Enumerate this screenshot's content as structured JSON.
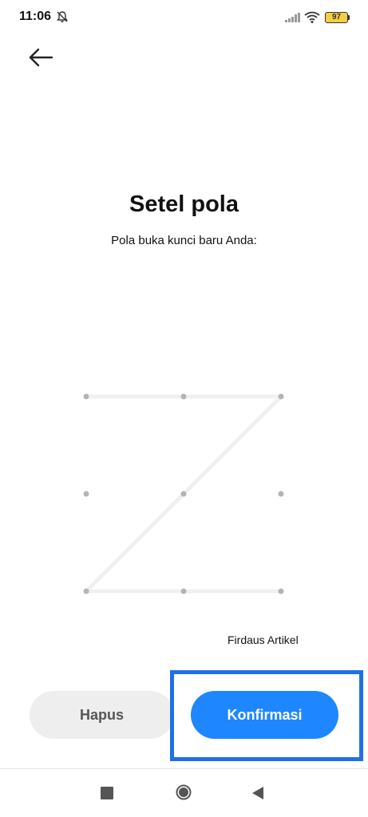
{
  "status_bar": {
    "time": "11:06",
    "battery_level": "97",
    "icons": [
      "mute-bell-icon",
      "signal-icon",
      "wifi-icon",
      "battery-icon"
    ]
  },
  "header": {
    "back_icon": "arrow-left-icon"
  },
  "main": {
    "title": "Setel pola",
    "subtitle": "Pola buka kunci baru Anda:"
  },
  "pattern": {
    "grid": "3x3",
    "sequence": [
      1,
      2,
      3,
      5,
      7,
      8,
      9
    ],
    "line_color": "#f0f0f0",
    "dot_color": "#b4b4b4"
  },
  "watermark": {
    "text": "Firdaus Artikel"
  },
  "actions": {
    "clear_label": "Hapus",
    "confirm_label": "Konfirmasi",
    "confirm_color": "#1e86ff",
    "highlight_color": "#1f6fe8"
  },
  "nav_bar": {
    "icons": [
      "recents-square-icon",
      "home-circle-icon",
      "back-triangle-icon"
    ]
  }
}
